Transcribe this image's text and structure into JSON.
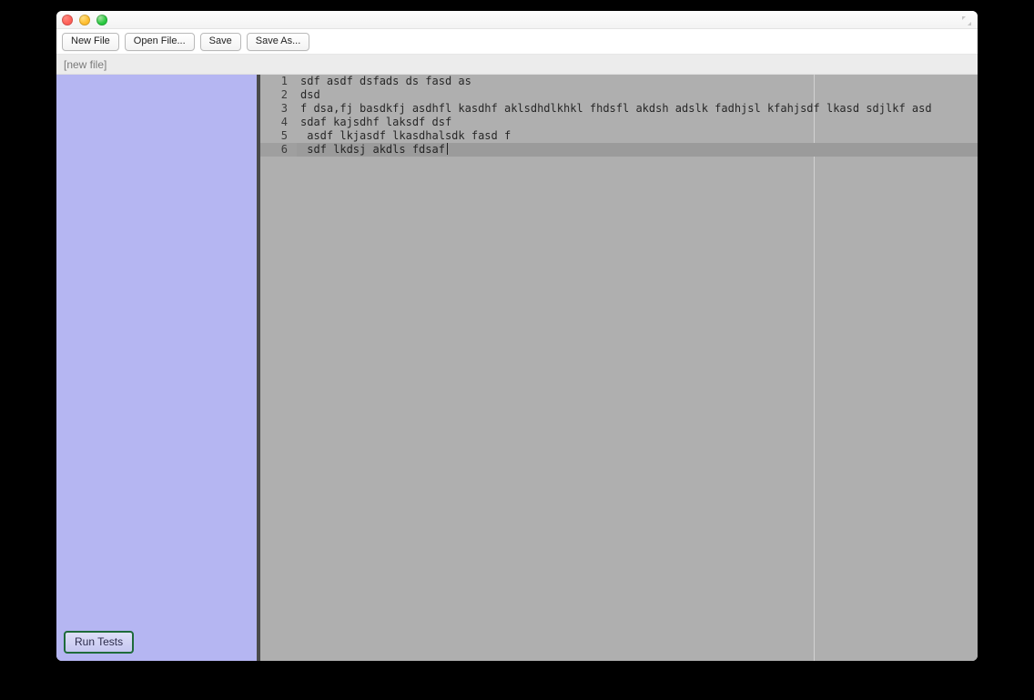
{
  "toolbar": {
    "new_file": "New File",
    "open_file": "Open File...",
    "save": "Save",
    "save_as": "Save As..."
  },
  "pathbar": {
    "label": "[new file]"
  },
  "sidebar": {
    "run_tests": "Run Tests"
  },
  "editor": {
    "active_line_index": 5,
    "cursor_after_active_text": true,
    "lines": [
      "sdf asdf dsfads ds fasd as",
      "dsd",
      "f dsa,fj basdkfj asdhfl kasdhf aklsdhdlkhkl fhdsfl akdsh adslk fadhjsl kfahjsdf lkasd sdjlkf asd",
      "sdaf kajsdhf laksdf dsf",
      " asdf lkjasdf lkasdhalsdk fasd f",
      " sdf lkdsj akdls fdsaf"
    ]
  }
}
